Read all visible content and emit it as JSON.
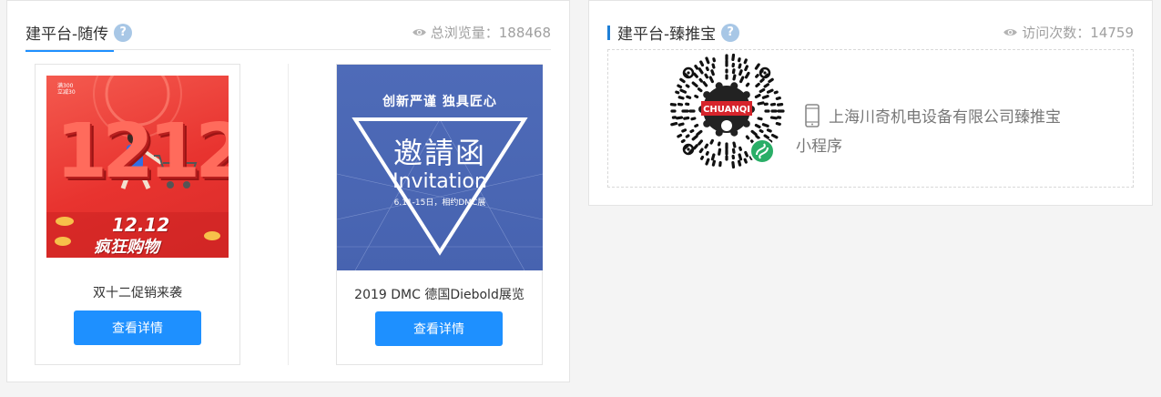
{
  "left_panel": {
    "title": "建平台-随传",
    "help": "?",
    "stat_label": "总浏览量：",
    "stat_value": "188468",
    "cards": [
      {
        "caption": "双十二促销来袭",
        "button": "查看详情",
        "image": {
          "numerals": "1212",
          "top_line_1": "满300",
          "top_line_2": "立减30",
          "slogan_1": "12.12",
          "slogan_2": "疯狂购物"
        }
      },
      {
        "caption": "2019 DMC 德国Diebold展览",
        "button": "查看详情",
        "image": {
          "headline": "创新严谨  独具匠心",
          "title_cn": "邀請函",
          "title_en": "Invitation",
          "date_line": "6.11-15日，相约DMC展"
        }
      }
    ]
  },
  "right_panel": {
    "title": "建平台-臻推宝",
    "help": "?",
    "stat_label": "访问次数：",
    "stat_value": "14759",
    "qr_brand": "CHUANQI",
    "mini_program_text": "上海川奇机电设备有限公司臻推宝小程序"
  },
  "colors": {
    "accent": "#1e90ff",
    "page_bg": "#f4f4f4",
    "muted_text": "#a0a0a0",
    "mini_program_green": "#2aae67",
    "brand_red": "#d6242b"
  }
}
